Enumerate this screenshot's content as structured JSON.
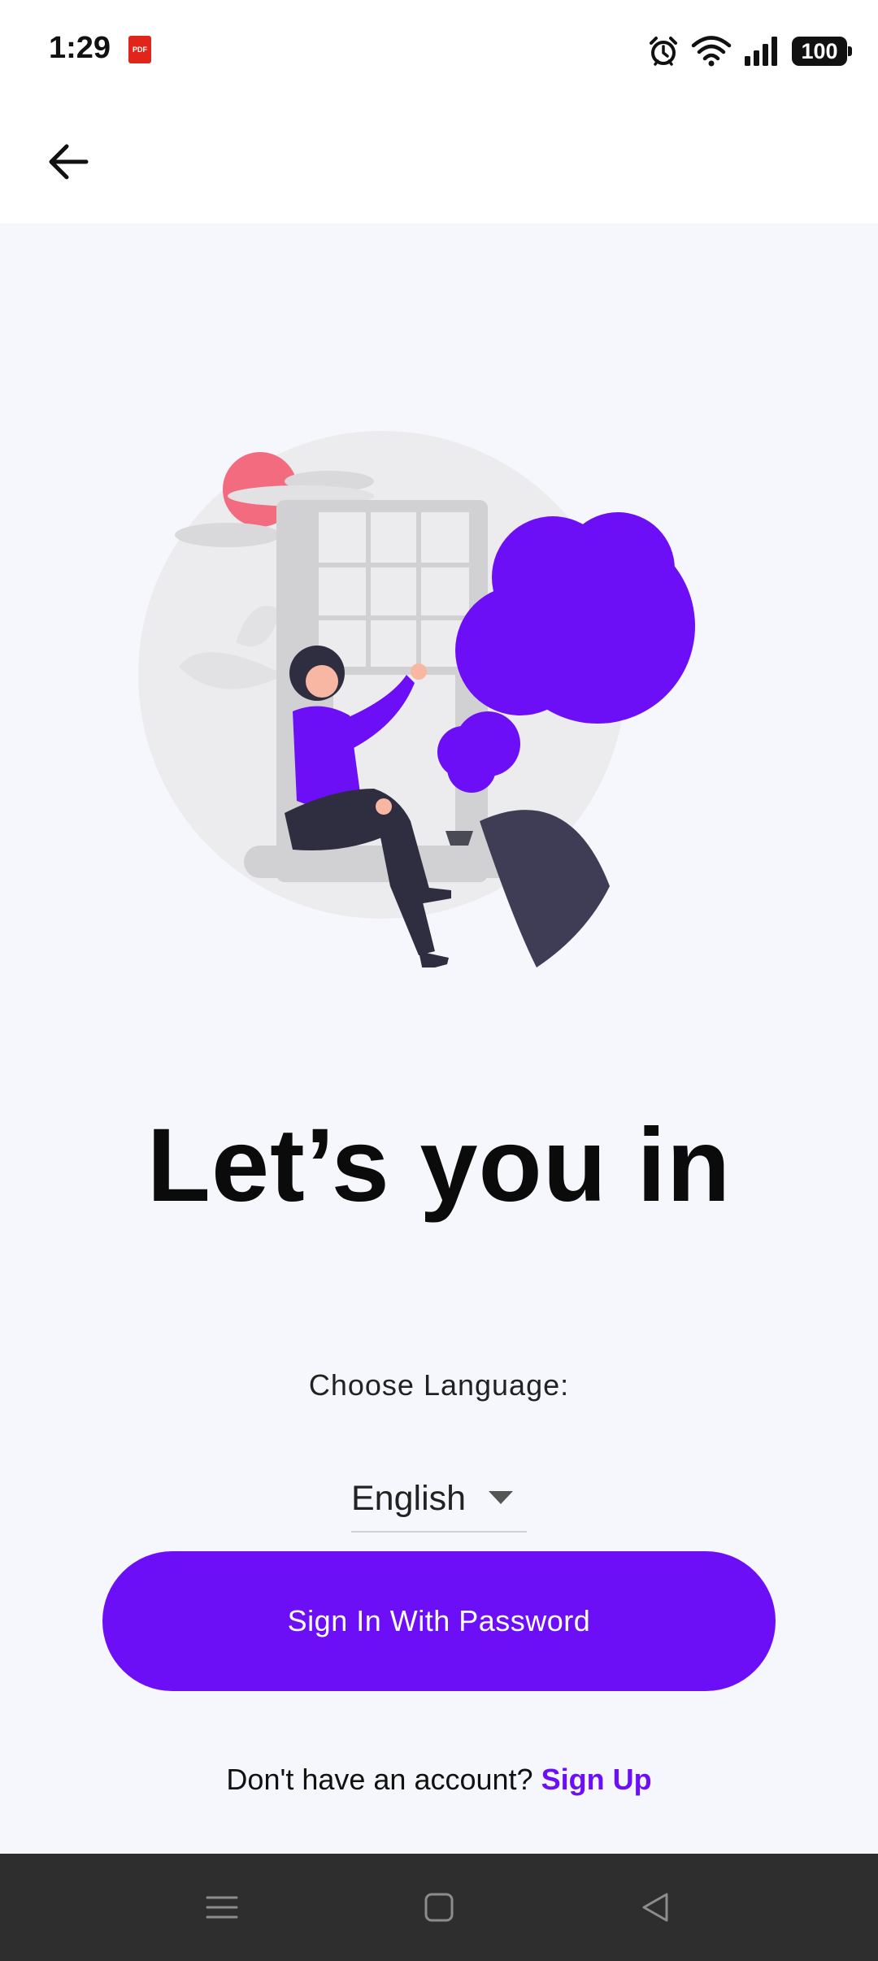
{
  "status_bar": {
    "time": "1:29",
    "pdf_badge": "PDF",
    "battery": "100"
  },
  "header": {
    "back_icon": "arrow-left-icon"
  },
  "main": {
    "illustration": "woman-sitting-at-window-with-tree",
    "title": "Let’s you in",
    "language_label": "Choose Language:",
    "language_value": "English",
    "primary_button": "Sign In With Password",
    "signup_prompt": "Don't have an account?",
    "signup_link": "Sign Up"
  },
  "nav_bar": {
    "items": [
      "menu-icon",
      "home-icon",
      "back-icon"
    ]
  },
  "colors": {
    "accent": "#6c0ff7",
    "background": "#f6f7fc",
    "nav_background": "#2e2e2e"
  }
}
